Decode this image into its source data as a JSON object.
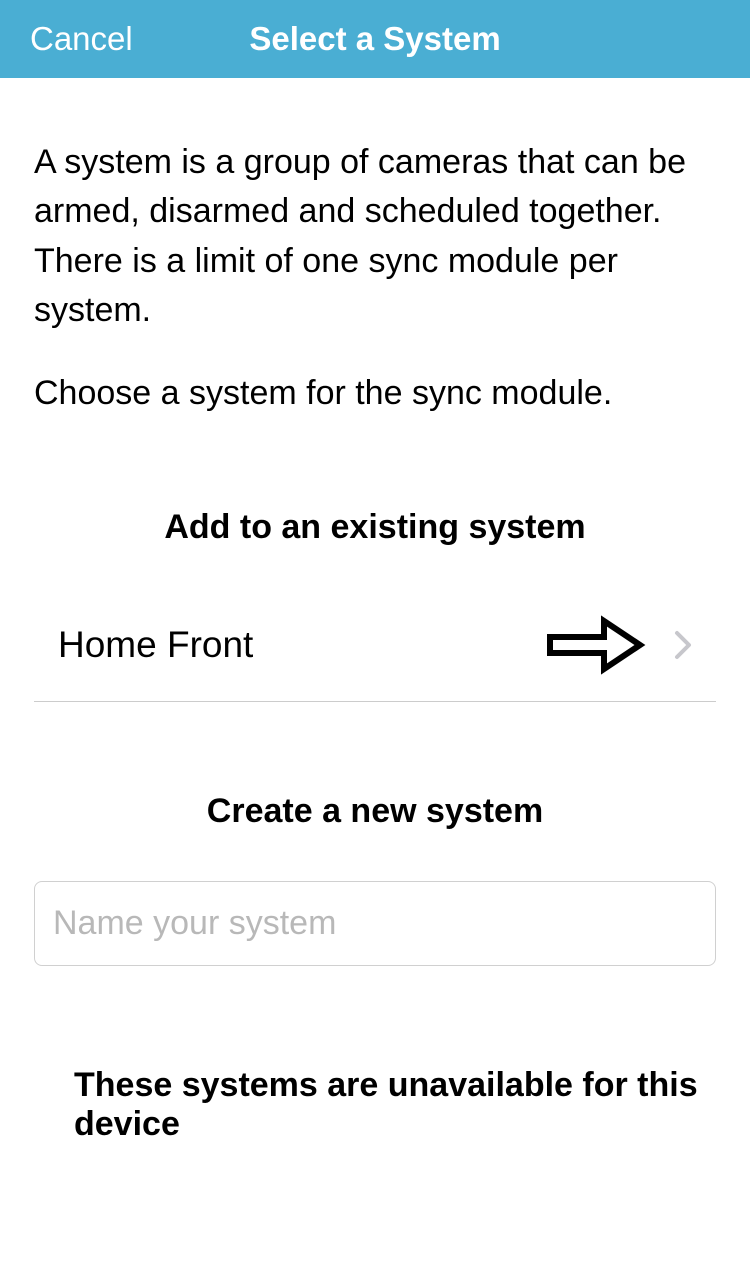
{
  "header": {
    "cancel_label": "Cancel",
    "title": "Select a System"
  },
  "description": {
    "paragraph1": "A system is a group of cameras that can be armed, disarmed and scheduled together. There is a limit of one sync module per system.",
    "paragraph2": "Choose a system for the sync module."
  },
  "sections": {
    "existing_heading": "Add to an existing system",
    "create_heading": "Create a new system",
    "unavailable_heading": "These systems are unavailable for this device"
  },
  "existing_systems": [
    {
      "name": "Home Front"
    }
  ],
  "create": {
    "placeholder": "Name your system",
    "value": ""
  }
}
